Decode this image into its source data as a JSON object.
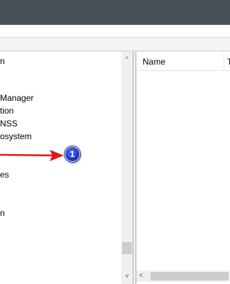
{
  "tree": {
    "items": [
      {
        "label": "n"
      },
      {
        "label": "Manager"
      },
      {
        "label": "tion"
      },
      {
        "label": "NSS"
      },
      {
        "label": "osystem"
      },
      {
        "label": "es"
      },
      {
        "label": "n"
      }
    ]
  },
  "list": {
    "columns": [
      {
        "label": "Name"
      },
      {
        "label": "T"
      }
    ]
  },
  "scrollbar": {
    "up_arrow": "^",
    "down_arrow": "v",
    "left_arrow": "<"
  },
  "callout": {
    "number": "1",
    "arrow_color": "#e01818",
    "badge_color": "#1f2fb8"
  }
}
